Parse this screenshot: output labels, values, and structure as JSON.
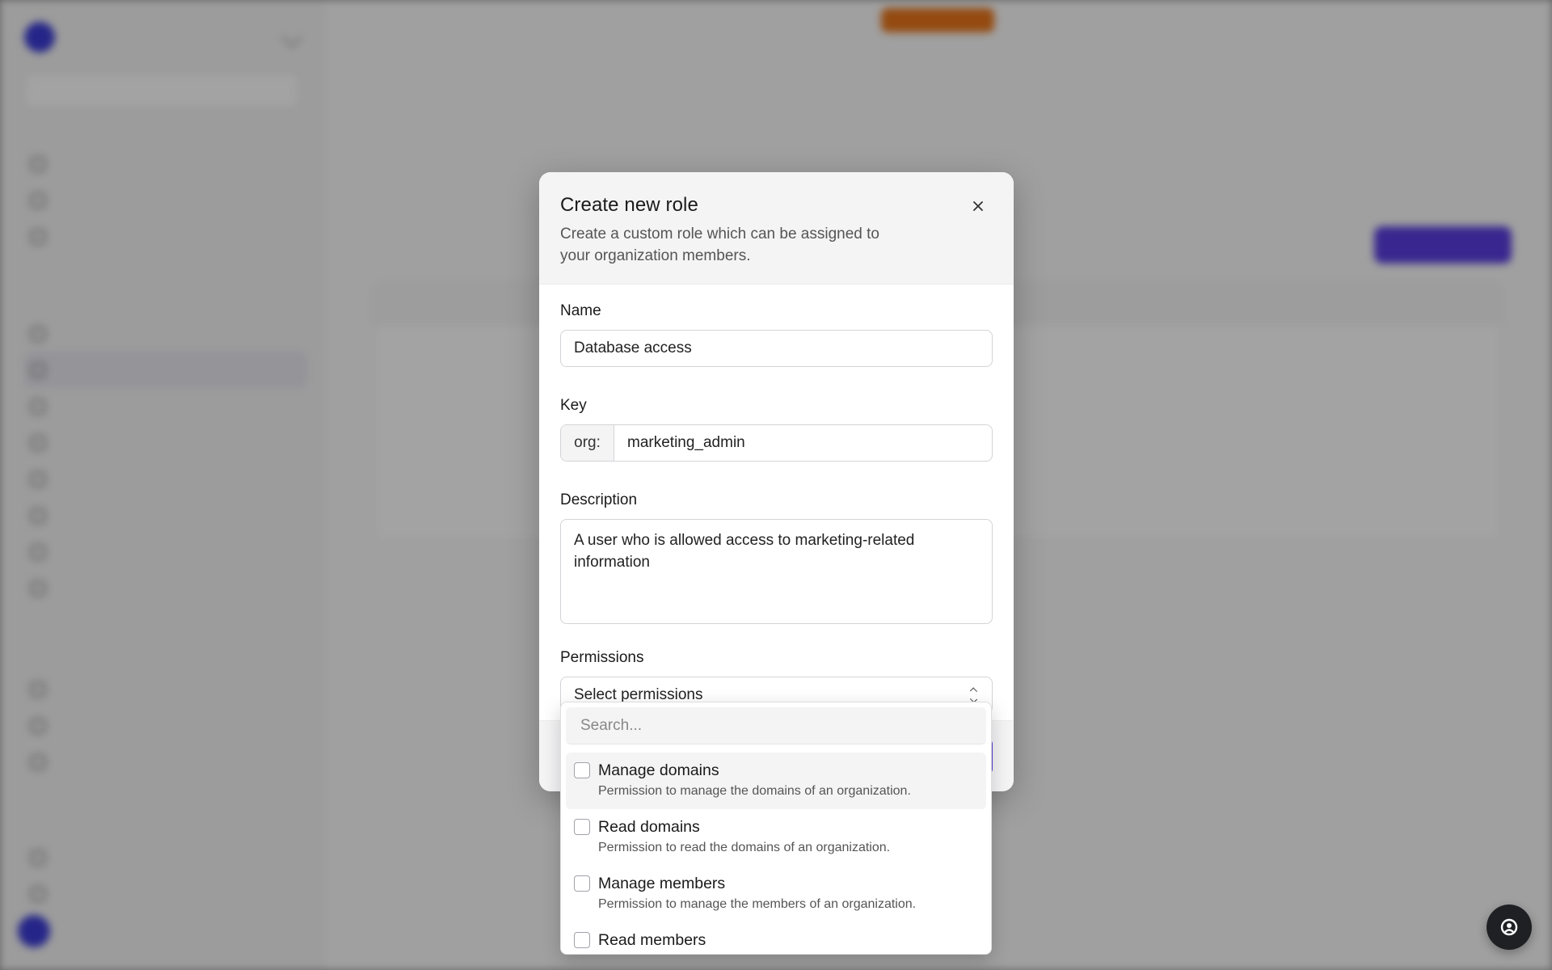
{
  "modal": {
    "title": "Create new role",
    "subtitle": "Create a custom role which can be assigned to your organization members.",
    "close_icon": "close-icon",
    "fields": {
      "name": {
        "label": "Name",
        "value": "Database access"
      },
      "key": {
        "label": "Key",
        "prefix": "org:",
        "value": "marketing_admin"
      },
      "description": {
        "label": "Description",
        "value": "A user who is allowed access to marketing-related information"
      },
      "permissions": {
        "label": "Permissions",
        "value": "Select permissions",
        "icon": "chevron-up-down-icon"
      }
    }
  },
  "dropdown": {
    "search_placeholder": "Search...",
    "options": [
      {
        "title": "Manage domains",
        "desc": "Permission to manage the domains of an organization."
      },
      {
        "title": "Read domains",
        "desc": "Permission to read the domains of an organization."
      },
      {
        "title": "Manage members",
        "desc": "Permission to manage the members of an organization."
      },
      {
        "title": "Read members",
        "desc": ""
      }
    ]
  },
  "colors": {
    "accent": "#5a3ee0",
    "warning_pill": "#e8751a",
    "modal_header_bg": "#f4f4f5"
  }
}
